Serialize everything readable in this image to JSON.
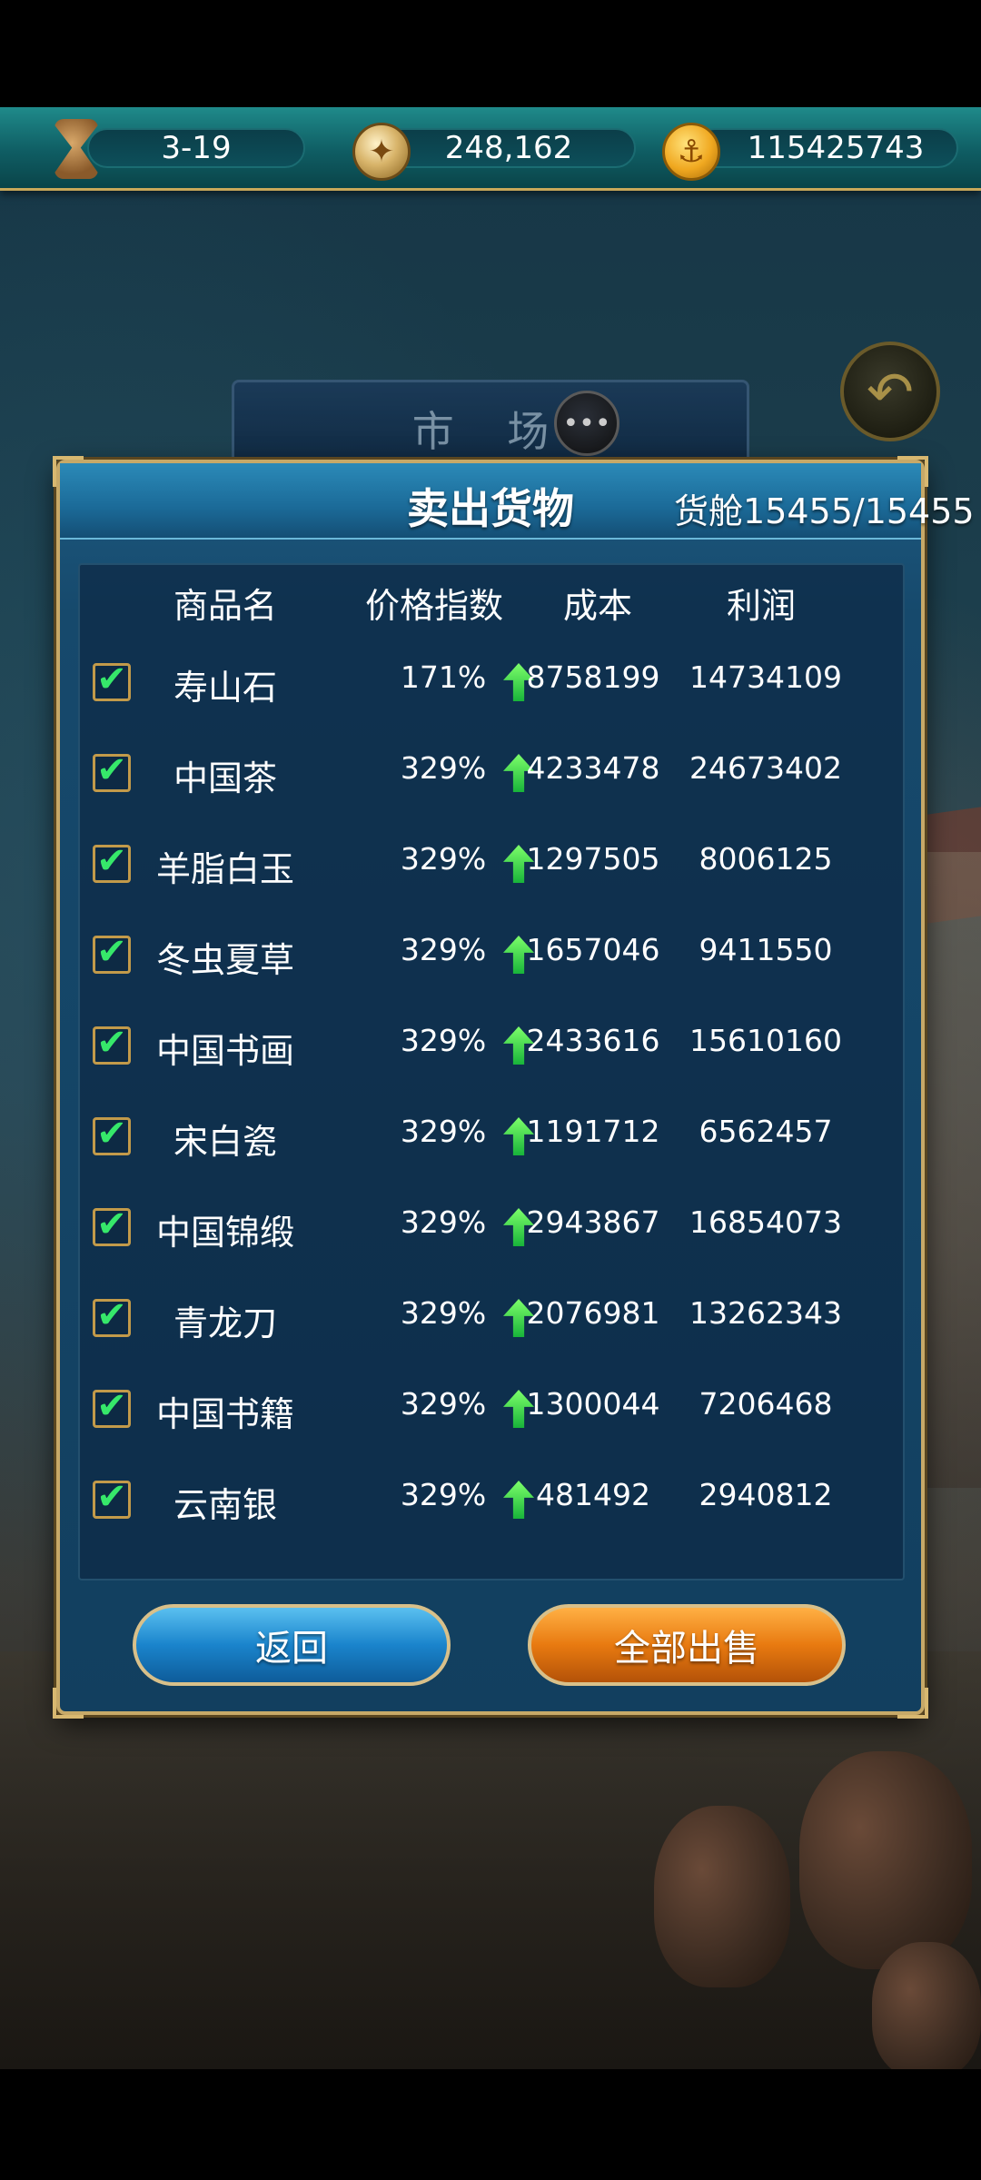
{
  "resources": {
    "date": "3-19",
    "reputation": "248,162",
    "gold": "115425743"
  },
  "market_tab": {
    "title": "市 场"
  },
  "dialog": {
    "title": "卖出货物",
    "cargo_label": "货舱",
    "cargo_value": "15455/15455"
  },
  "table": {
    "headers": {
      "name": "商品名",
      "price_index": "价格指数",
      "cost": "成本",
      "profit": "利润"
    },
    "rows": [
      {
        "name": "寿山石",
        "price_index": "171%",
        "cost": "8758199",
        "profit": "14734109",
        "checked": true,
        "trend": "up"
      },
      {
        "name": "中国茶",
        "price_index": "329%",
        "cost": "4233478",
        "profit": "24673402",
        "checked": true,
        "trend": "up"
      },
      {
        "name": "羊脂白玉",
        "price_index": "329%",
        "cost": "1297505",
        "profit": "8006125",
        "checked": true,
        "trend": "up"
      },
      {
        "name": "冬虫夏草",
        "price_index": "329%",
        "cost": "1657046",
        "profit": "9411550",
        "checked": true,
        "trend": "up"
      },
      {
        "name": "中国书画",
        "price_index": "329%",
        "cost": "2433616",
        "profit": "15610160",
        "checked": true,
        "trend": "up"
      },
      {
        "name": "宋白瓷",
        "price_index": "329%",
        "cost": "1191712",
        "profit": "6562457",
        "checked": true,
        "trend": "up"
      },
      {
        "name": "中国锦缎",
        "price_index": "329%",
        "cost": "2943867",
        "profit": "16854073",
        "checked": true,
        "trend": "up"
      },
      {
        "name": "青龙刀",
        "price_index": "329%",
        "cost": "2076981",
        "profit": "13262343",
        "checked": true,
        "trend": "up"
      },
      {
        "name": "中国书籍",
        "price_index": "329%",
        "cost": "1300044",
        "profit": "7206468",
        "checked": true,
        "trend": "up"
      },
      {
        "name": "云南银",
        "price_index": "329%",
        "cost": "481492",
        "profit": "2940812",
        "checked": true,
        "trend": "up"
      }
    ]
  },
  "buttons": {
    "back": "返回",
    "sell_all": "全部出售"
  },
  "colors": {
    "accent_gold": "#c7a968",
    "check_green": "#36e86a",
    "sell_orange": "#e87a10",
    "back_blue": "#1a84cc"
  }
}
